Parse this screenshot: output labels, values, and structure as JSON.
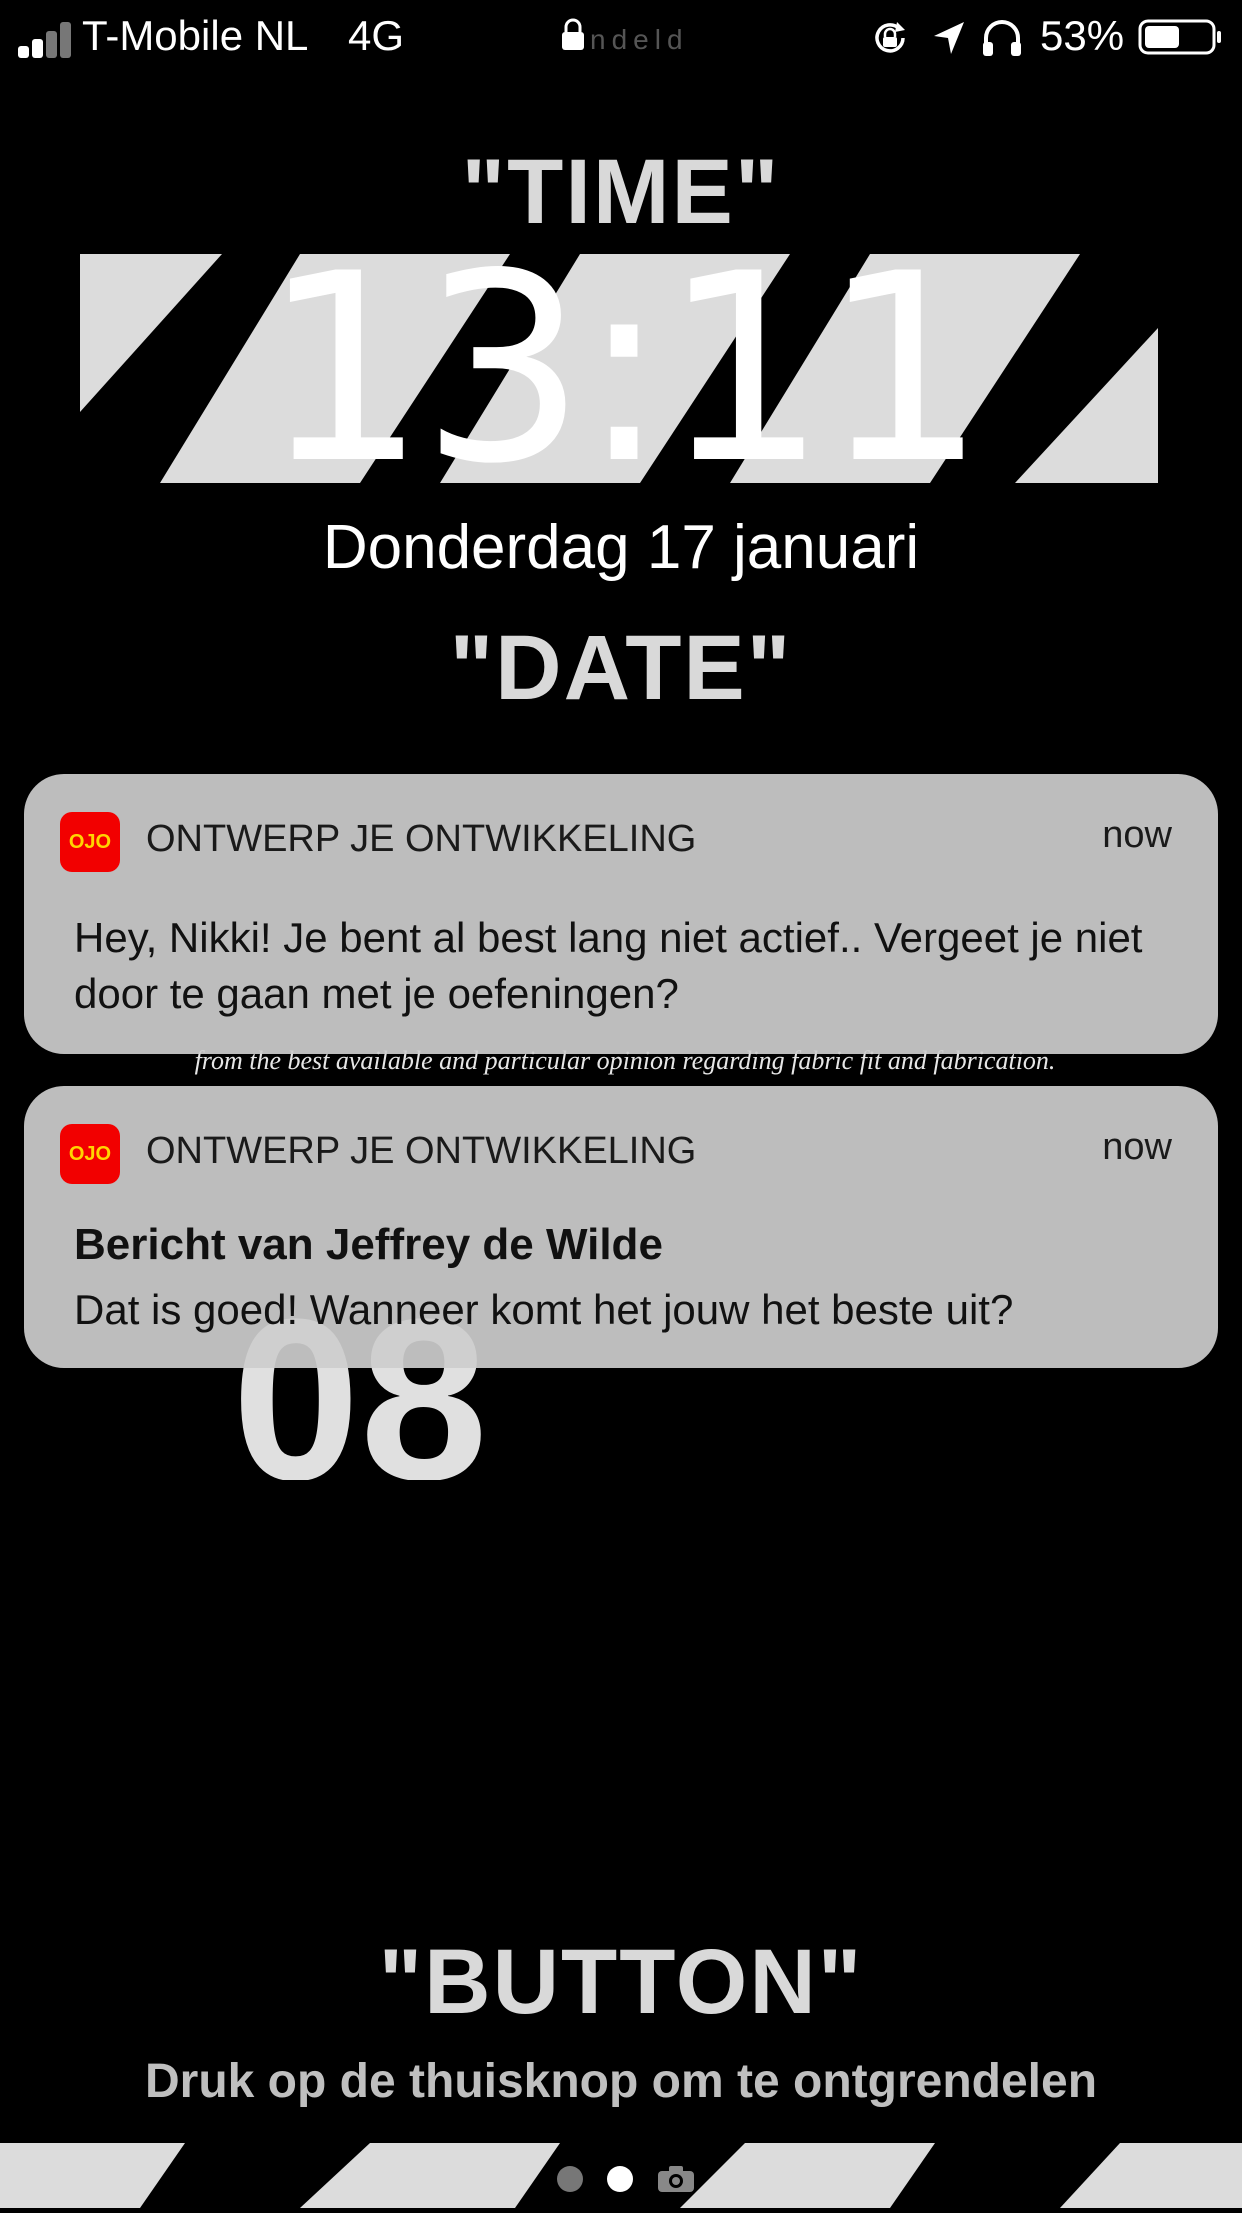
{
  "status_bar": {
    "carrier": "T-Mobile NL",
    "network": "4G",
    "lock_text": "ndeld",
    "battery_percent": "53%",
    "battery_level": 0.53
  },
  "wallpaper": {
    "time_word": "\"TIME\"",
    "date_word": "\"DATE\"",
    "button_word": "\"BUTTON\"",
    "number": "08",
    "script_line": "from the best available and particular opinion regarding fabric fit and fabrication."
  },
  "lockscreen": {
    "time": "13:11",
    "date": "Donderdag 17 januari",
    "unlock_hint": "Druk op de thuisknop om te ontgrendelen"
  },
  "notifications": [
    {
      "icon_text": "OJO",
      "app": "ONTWERP JE ONTWIKKELING",
      "time": "now",
      "title": "",
      "body": "Hey, Nikki! Je bent al best lang niet actief.. Vergeet je niet door te gaan met je oefeningen?"
    },
    {
      "icon_text": "OJO",
      "app": "ONTWERP JE ONTWIKKELING",
      "time": "now",
      "title": "Bericht van Jeffrey de Wilde",
      "body": "Dat is goed! Wanneer komt het jouw het beste uit?"
    }
  ],
  "page_indicator": {
    "pages": 2,
    "active": 2
  },
  "colors": {
    "app_icon_bg": "#f20000",
    "app_icon_text": "#ffd400",
    "wallpaper_stripe": "#d9d9d9"
  }
}
